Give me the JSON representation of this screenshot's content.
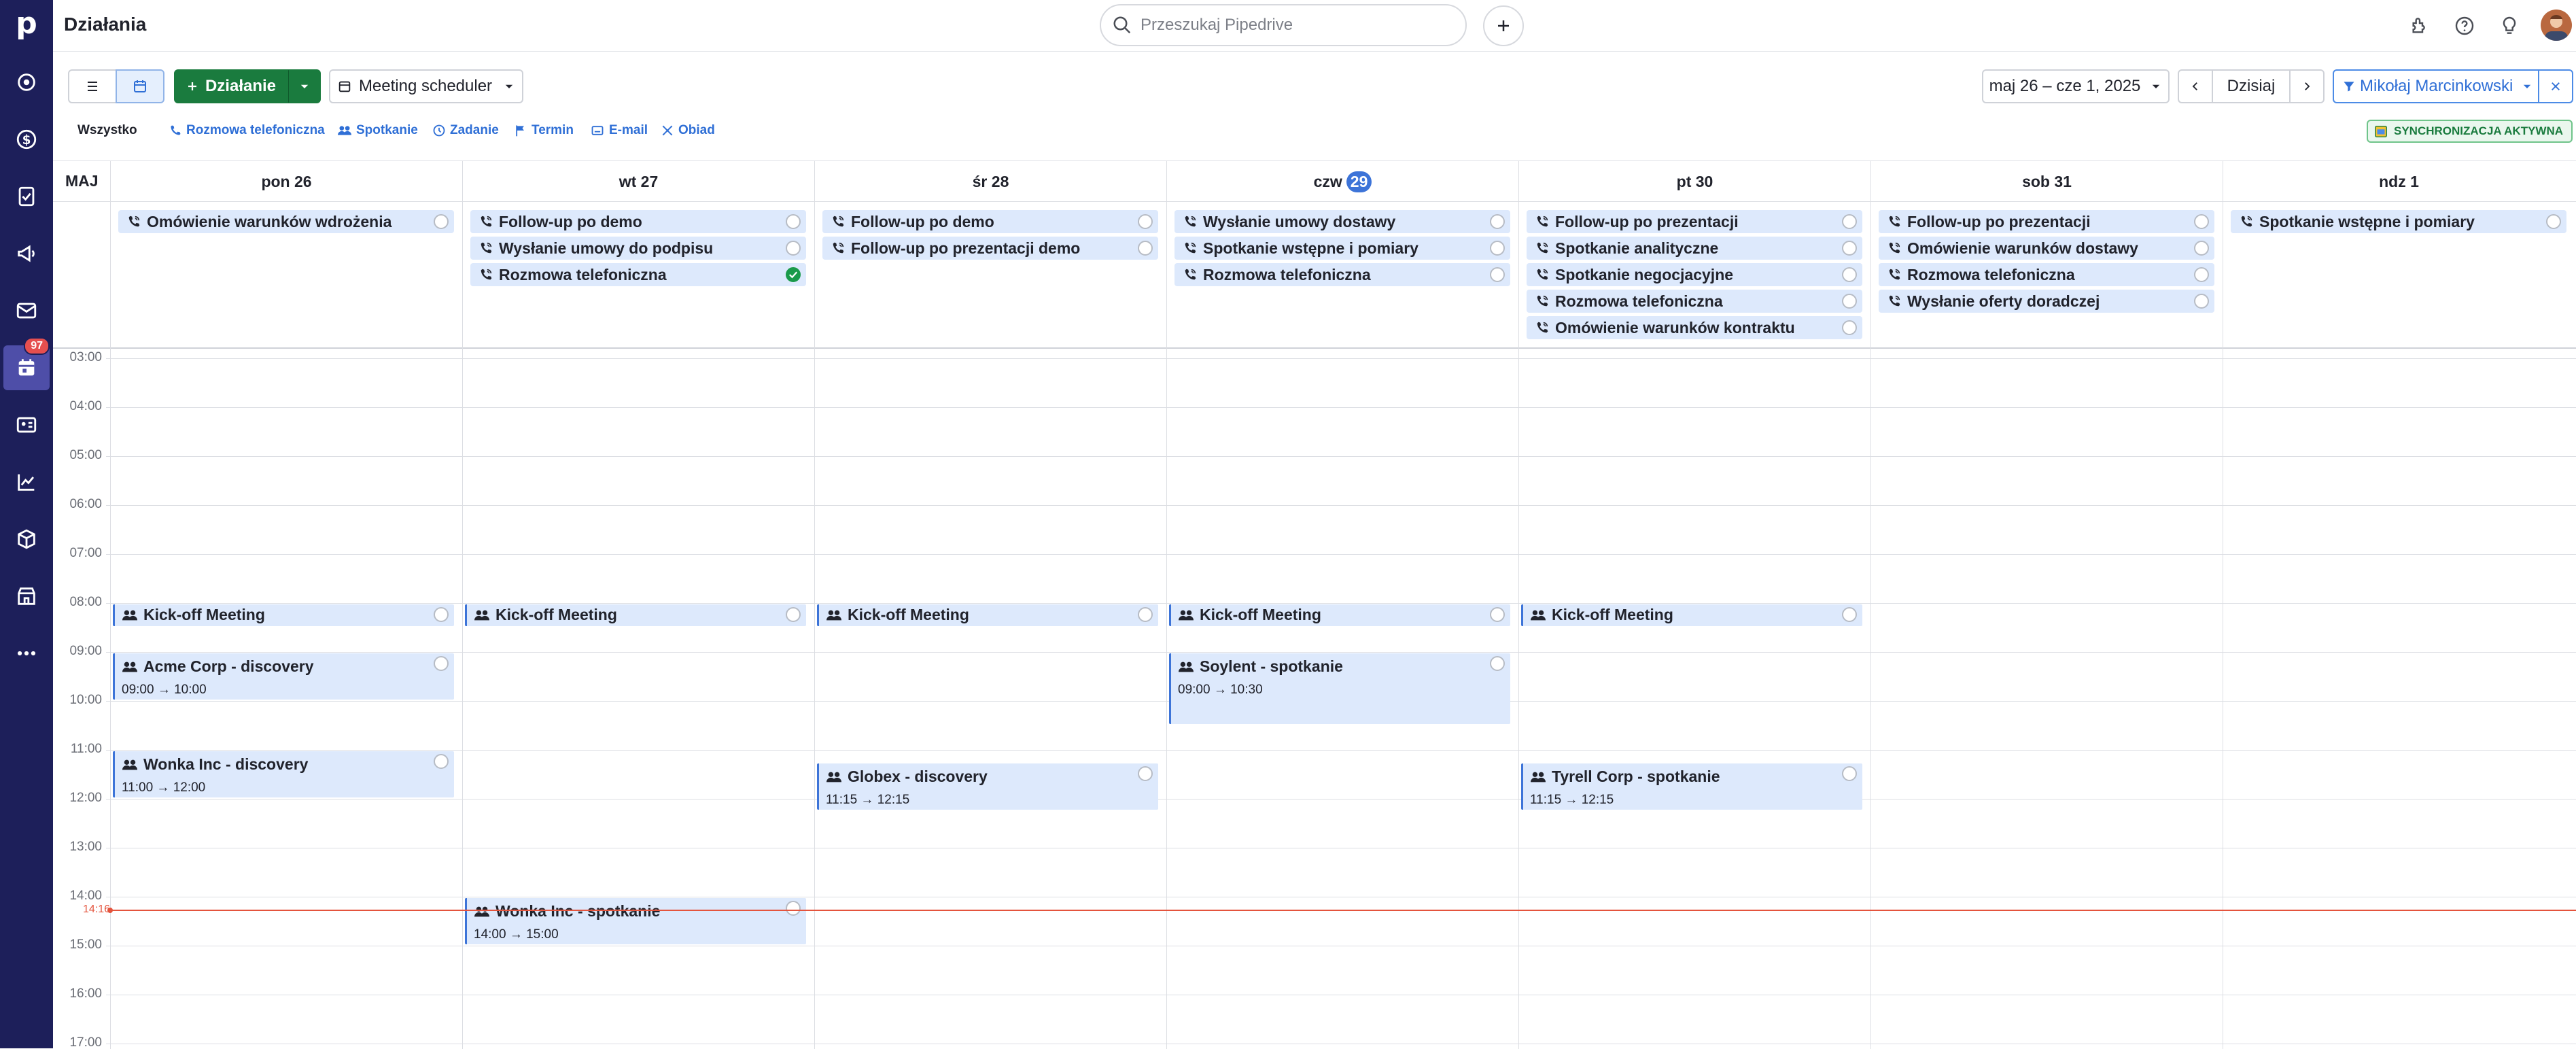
{
  "app": {
    "title": "Działania"
  },
  "search": {
    "placeholder": "Przeszukaj Pipedrive"
  },
  "sidebar": {
    "logo": "p",
    "items": [
      {
        "name": "leads",
        "icon": "target-icon"
      },
      {
        "name": "deals",
        "icon": "dollar-icon"
      },
      {
        "name": "tasks",
        "icon": "checklist-icon"
      },
      {
        "name": "campaigns",
        "icon": "megaphone-icon"
      },
      {
        "name": "mail",
        "icon": "mail-icon"
      },
      {
        "name": "activities",
        "icon": "calendar-icon",
        "badge": "97",
        "active": true
      },
      {
        "name": "contacts",
        "icon": "contact-card-icon"
      },
      {
        "name": "insights",
        "icon": "chart-line-icon"
      },
      {
        "name": "products",
        "icon": "box-icon"
      },
      {
        "name": "marketplace",
        "icon": "store-icon"
      },
      {
        "name": "more",
        "icon": "more-icon"
      }
    ]
  },
  "toolbar": {
    "add_activity": "Działanie",
    "scheduler": "Meeting scheduler",
    "date_range": "maj 26 – cze 1, 2025",
    "today": "Dzisiaj",
    "assignee": "Mikołaj Marcinkowski"
  },
  "filters": {
    "all": "Wszystko",
    "types": [
      "Rozmowa telefoniczna",
      "Spotkanie",
      "Zadanie",
      "Termin",
      "E-mail",
      "Obiad"
    ],
    "sync": "SYNCHRONIZACJA AKTYWNA"
  },
  "calendar": {
    "month": "MAJ",
    "days": [
      {
        "label": "pon 26"
      },
      {
        "label": "wt 27"
      },
      {
        "label": "śr 28"
      },
      {
        "label": "czw",
        "num": "29",
        "today": true
      },
      {
        "label": "pt 30"
      },
      {
        "label": "sob 31"
      },
      {
        "label": "ndz 1"
      }
    ],
    "hours": [
      "03:00",
      "04:00",
      "05:00",
      "06:00",
      "07:00",
      "08:00",
      "09:00",
      "10:00",
      "11:00",
      "12:00",
      "13:00",
      "14:00",
      "15:00",
      "16:00",
      "17:00"
    ],
    "now": "14:16",
    "all_day": [
      [
        "Omówienie warunków wdrożenia"
      ],
      [
        "Follow-up po demo",
        "Wysłanie umowy do podpisu",
        "Rozmowa telefoniczna"
      ],
      [
        "Follow-up po demo",
        "Follow-up po prezentacji demo"
      ],
      [
        "Wysłanie umowy dostawy",
        "Spotkanie wstępne i pomiary",
        "Rozmowa telefoniczna"
      ],
      [
        "Follow-up po prezentacji",
        "Spotkanie analityczne",
        "Spotkanie negocjacyjne",
        "Rozmowa telefoniczna",
        "Omówienie warunków kontraktu"
      ],
      [
        "Follow-up po prezentacji",
        "Omówienie warunków dostawy",
        "Rozmowa telefoniczna",
        "Wysłanie oferty doradczej"
      ],
      [
        "Spotkanie wstępne i pomiary"
      ]
    ],
    "events": [
      {
        "day": 0,
        "title": "Kick-off Meeting",
        "start": 8.0,
        "end": 8.5
      },
      {
        "day": 1,
        "title": "Kick-off Meeting",
        "start": 8.0,
        "end": 8.5
      },
      {
        "day": 2,
        "title": "Kick-off Meeting",
        "start": 8.0,
        "end": 8.5
      },
      {
        "day": 3,
        "title": "Kick-off Meeting",
        "start": 8.0,
        "end": 8.5
      },
      {
        "day": 4,
        "title": "Kick-off Meeting",
        "start": 8.0,
        "end": 8.5
      },
      {
        "day": 0,
        "title": "Acme Corp - discovery",
        "time": "09:00 → 10:00",
        "start": 9.0,
        "end": 10.0
      },
      {
        "day": 3,
        "title": "Soylent - spotkanie",
        "time": "09:00 → 10:30",
        "start": 9.0,
        "end": 10.5
      },
      {
        "day": 0,
        "title": "Wonka Inc - discovery",
        "time": "11:00 → 12:00",
        "start": 11.0,
        "end": 12.0
      },
      {
        "day": 2,
        "title": "Globex - discovery",
        "time": "11:15 → 12:15",
        "start": 11.25,
        "end": 12.25
      },
      {
        "day": 4,
        "title": "Tyrell Corp - spotkanie",
        "time": "11:15 → 12:15",
        "start": 11.25,
        "end": 12.25
      },
      {
        "day": 1,
        "title": "Wonka Inc - spotkanie",
        "time": "14:00 → 15:00",
        "start": 14.0,
        "end": 15.0
      }
    ]
  }
}
